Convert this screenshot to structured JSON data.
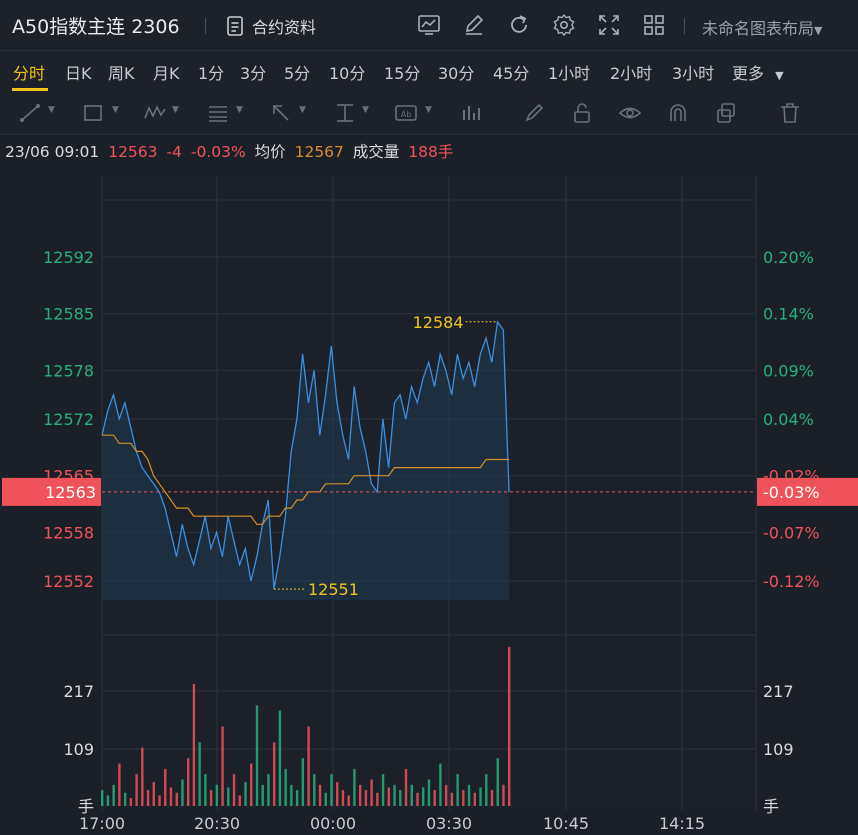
{
  "header": {
    "title": "A50指数主连 2306",
    "contract_label": "合约资料",
    "layout_label": "未命名图表布局"
  },
  "periods": [
    "分时",
    "日K",
    "周K",
    "月K",
    "1分",
    "3分",
    "5分",
    "10分",
    "15分",
    "30分",
    "45分",
    "1小时",
    "2小时",
    "3小时",
    "更多"
  ],
  "active_period": "分时",
  "toolbar_icons": [
    "chart-icon",
    "edit-icon",
    "refresh-icon",
    "settings-icon",
    "fullscreen-icon",
    "grid-layout-icon"
  ],
  "draw_tools": [
    "line-tool-icon",
    "rectangle-tool-icon",
    "pattern-tool-icon",
    "fib-tool-icon",
    "arrow-tool-icon",
    "measure-tool-icon",
    "text-tool-icon",
    "volume-profile-icon",
    "brush-icon",
    "lock-icon",
    "eye-icon",
    "magnet-icon",
    "copy-icon",
    "trash-icon"
  ],
  "info": {
    "time": "23/06 09:01",
    "price": "12563",
    "change": "-4",
    "change_pct": "-0.03%",
    "avg_label": "均价",
    "avg_value": "12567",
    "volume_label": "成交量",
    "volume_value": "188手"
  },
  "colors": {
    "up": "#26b07a",
    "down": "#f0525a",
    "price_line": "#3b8fe0",
    "avg_line": "#d4902e",
    "highlight": "#f0c419",
    "grid": "#2c323d"
  },
  "chart_data": {
    "type": "line",
    "prev_close": 12567,
    "price_ticks": [
      12592,
      12585,
      12578,
      12572,
      12565,
      12558,
      12552
    ],
    "pct_ticks": [
      "0.20%",
      "0.14%",
      "0.09%",
      "0.04%",
      "-0.02%",
      "-0.07%",
      "-0.12%"
    ],
    "current_price": "12563",
    "current_pct": "-0.03%",
    "max_label": "12584",
    "min_label": "12551",
    "volume_ticks": [
      217,
      109
    ],
    "volume_unit": "手",
    "x_ticks": [
      "17:00",
      "20:30",
      "00:00",
      "03:30",
      "10:45",
      "14:15"
    ],
    "series": [
      {
        "values": [
          12570,
          12573,
          12575,
          12572,
          12574,
          12571,
          12568,
          12566,
          12565,
          12564,
          12563,
          12561,
          12558,
          12555,
          12559,
          12556,
          12554,
          12557,
          12560,
          12556,
          12558,
          12555,
          12560,
          12557,
          12554,
          12556,
          12552,
          12555,
          12559,
          12562,
          12551,
          12555,
          12560,
          12568,
          12572,
          12580,
          12574,
          12578,
          12570,
          12575,
          12581,
          12574,
          12570,
          12567,
          12576,
          12571,
          12568,
          12564,
          12563,
          12572,
          12566,
          12574,
          12575,
          12572,
          12576,
          12574,
          12577,
          12579,
          12576,
          12580,
          12578,
          12575,
          12580,
          12577,
          12579,
          12576,
          12580,
          12582,
          12579,
          12584,
          12583,
          12563
        ]
      },
      {
        "values": [
          12570,
          12570,
          12570,
          12569,
          12569,
          12569,
          12568,
          12568,
          12567,
          12565,
          12564,
          12563,
          12562,
          12561,
          12561,
          12561,
          12560,
          12560,
          12560,
          12560,
          12560,
          12560,
          12560,
          12560,
          12560,
          12560,
          12560,
          12559,
          12559,
          12560,
          12560,
          12560,
          12561,
          12561,
          12562,
          12562,
          12563,
          12563,
          12563,
          12564,
          12564,
          12564,
          12564,
          12564,
          12565,
          12565,
          12565,
          12565,
          12565,
          12565,
          12565,
          12566,
          12566,
          12566,
          12566,
          12566,
          12566,
          12566,
          12566,
          12566,
          12566,
          12566,
          12566,
          12566,
          12566,
          12566,
          12566,
          12567,
          12567,
          12567,
          12567,
          12567
        ]
      }
    ],
    "volume": [
      30,
      20,
      40,
      80,
      25,
      15,
      60,
      110,
      30,
      45,
      20,
      70,
      35,
      25,
      50,
      90,
      230,
      120,
      60,
      30,
      40,
      150,
      35,
      60,
      20,
      45,
      80,
      190,
      40,
      60,
      120,
      180,
      70,
      40,
      30,
      90,
      150,
      60,
      40,
      25,
      60,
      45,
      30,
      20,
      70,
      40,
      30,
      50,
      25,
      60,
      35,
      40,
      30,
      70,
      40,
      25,
      35,
      50,
      30,
      80,
      40,
      25,
      60,
      30,
      40,
      25,
      35,
      60,
      30,
      90,
      40,
      300
    ],
    "grid": true
  }
}
